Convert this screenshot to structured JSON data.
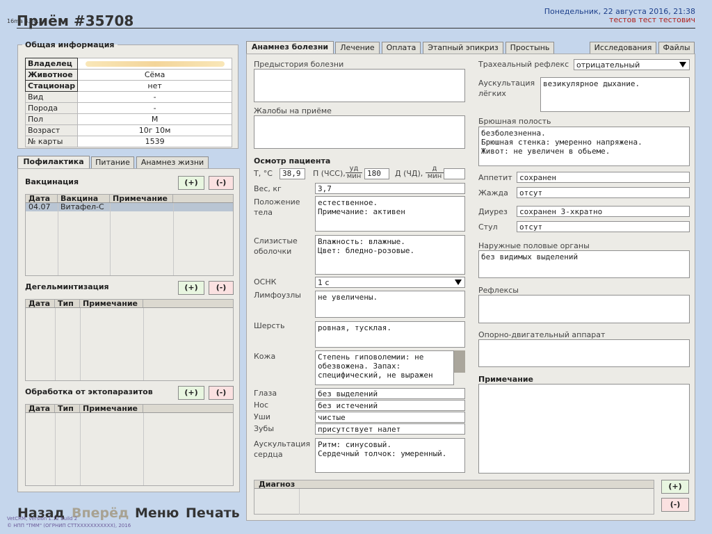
{
  "header": {
    "title": "Приём #35708",
    "tiny_text": "16ma 4.50.2",
    "date": "Понедельник, 22 августа 2016, 21:38",
    "user": "тестов тест тестович"
  },
  "general": {
    "legend": "Общая информация",
    "rows": [
      {
        "key": "Владелец",
        "value": ""
      },
      {
        "key": "Животное",
        "value": "Сёма"
      },
      {
        "key": "Стационар",
        "value": "нет"
      },
      {
        "key": "Вид",
        "value": "-"
      },
      {
        "key": "Порода",
        "value": "-"
      },
      {
        "key": "Пол",
        "value": "М"
      },
      {
        "key": "Возраст",
        "value": "10г 10м"
      },
      {
        "key": "№ карты",
        "value": "1539"
      }
    ]
  },
  "left_tabs": [
    "Пофилактика",
    "Питание",
    "Анамнез жизни"
  ],
  "vaccination": {
    "title": "Вакцинация",
    "add": "(+)",
    "del": "(-)",
    "columns": [
      "Дата",
      "Вакцина",
      "Примечание"
    ],
    "rows": [
      {
        "date": "04.07",
        "vaccine": "Витафел-С",
        "note": ""
      }
    ]
  },
  "deworming": {
    "title": "Дегельминтизация",
    "add": "(+)",
    "del": "(-)",
    "columns": [
      "Дата",
      "Тип",
      "Примечание"
    ]
  },
  "ectoparasites": {
    "title": "Обработка от эктопаразитов",
    "add": "(+)",
    "del": "(-)",
    "columns": [
      "Дата",
      "Тип",
      "Примечание"
    ]
  },
  "main_tabs": [
    "Анамнез болезни",
    "Лечение",
    "Оплата",
    "Этапный эпикриз",
    "Простынь"
  ],
  "right_tabs": [
    "Исследования",
    "Файлы"
  ],
  "form": {
    "history_label": "Предыстория болезни",
    "history_value": "",
    "complaints_label": "Жалобы на приёме",
    "complaints_value": "",
    "exam_title": "Осмотр пациента",
    "temp_label": "Т, °С",
    "temp_value": "38,9",
    "pulse_label": "П (ЧСС),",
    "pulse_unit_num": "уд",
    "pulse_unit_den": "мин",
    "pulse_value": "180",
    "resp_label": "Д (ЧД),",
    "resp_unit_num": "д",
    "resp_unit_den": "мин",
    "resp_value": "",
    "weight_label": "Вес, кг",
    "weight_value": "3,7",
    "position_label": "Положение тела",
    "position_value": "естественное.\nПримечание: активен",
    "mucous_label": "Слизистые оболочки",
    "mucous_value": "Влажность: влажные.\nЦвет: бледно-розовые.",
    "osnk_label": "ОСНК",
    "osnk_value": "1 с",
    "lymph_label": "Лимфоузлы",
    "lymph_value": "не увеличены.",
    "fur_label": "Шерсть",
    "fur_value": "ровная, тусклая.",
    "skin_label": "Кожа",
    "skin_value": "Степень гиповолемии: не обезвожена.\nЗапах: специфический, не выражен",
    "eyes_label": "Глаза",
    "eyes_value": "без выделений",
    "nose_label": "Нос",
    "nose_value": "без истечений",
    "ears_label": "Уши",
    "ears_value": "чистые",
    "teeth_label": "Зубы",
    "teeth_value": "присутствует налет",
    "heart_label": "Аускультация сердца",
    "heart_value": "Ритм: синусовый.\nСердечный толчок: умеренный.",
    "tracheal_label": "Трахеальный рефлекс",
    "tracheal_value": "отрицательный",
    "lungs_label": "Аускультация лёгких",
    "lungs_value": "везикулярное дыхание.",
    "abdomen_label": "Брюшная полость",
    "abdomen_value": "безболезненна.\nБрюшная стенка: умеренно напряжена.\nЖивот: не увеличен в обьеме.",
    "appetite_label": "Аппетит",
    "appetite_value": "сохранен",
    "thirst_label": "Жажда",
    "thirst_value": "отсут",
    "diuresis_label": "Диурез",
    "diuresis_value": "сохранен 3-хкратно",
    "stool_label": "Стул",
    "stool_value": "отсут",
    "genitals_label": "Наружные половые органы",
    "genitals_value": "без видимых выделений",
    "reflexes_label": "Рефлексы",
    "reflexes_value": "",
    "musculo_label": "Опорно-двигательный аппарат",
    "musculo_value": "",
    "note_label": "Примечание",
    "note_value": ""
  },
  "diagnosis": {
    "title": "Диагноз",
    "add": "(+)",
    "del": "(-)"
  },
  "nav": {
    "back": "Назад",
    "forward": "Вперёд",
    "menu": "Меню",
    "print": "Печать"
  },
  "footer": {
    "line1": "VetCRM, version 1.12 build 2",
    "line2": "© НПП \"ТММ\" (ОГРНИП СТТХХХХХХХХХХХ), 2016"
  },
  "colors": {
    "background": "#c5d6ec",
    "panel": "#ecebe6",
    "date": "#1d3f8a",
    "user": "#b0201a"
  }
}
